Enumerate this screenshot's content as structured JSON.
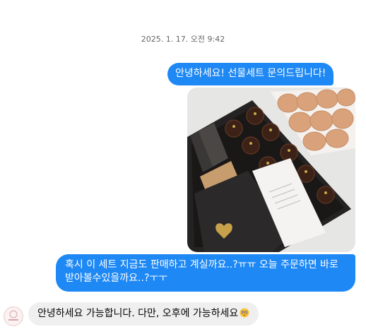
{
  "thread": {
    "timestamp": "2025. 1. 17. 오전 9:42",
    "messages": [
      {
        "from": "me",
        "text": "안녕하세요! 선물세트 문의드립니다!"
      },
      {
        "from": "me",
        "type": "photo",
        "icon": "photo-attachment"
      },
      {
        "from": "me",
        "text": "혹시 이 세트 지금도 판매하고 계실까요..?ㅠㅠ 오늘 주문하면 바로 받아볼수있을까요..?ㅜㅜ"
      },
      {
        "from": "shop",
        "text": "안녕하세요 가능합니다. 다만, 오후에 가능하세요",
        "emoji": "flushed-face-icon"
      }
    ]
  },
  "colors": {
    "outgoing_bubble": "#1e88f5",
    "incoming_bubble": "#efefef",
    "timestamp_text": "#65676b"
  }
}
